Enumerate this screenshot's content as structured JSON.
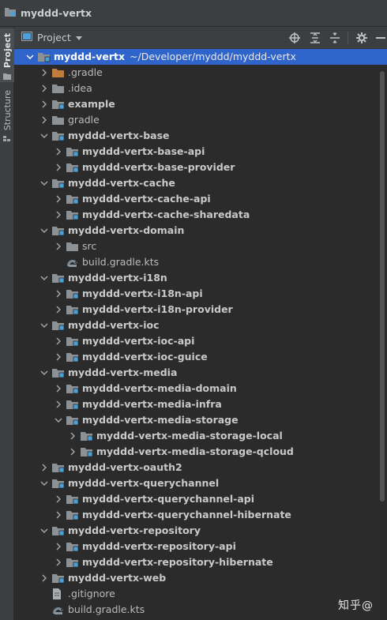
{
  "window": {
    "title": "myddd-vertx"
  },
  "sidebar_tabs": [
    {
      "label": "Project"
    },
    {
      "label": "Structure"
    }
  ],
  "toolbar": {
    "view_label": "Project"
  },
  "tree": [
    {
      "label": "myddd-vertx",
      "path": "~/Developer/myddd/myddd-vertx",
      "depth": 0,
      "expanded": true,
      "icon": "module-folder-icon",
      "bold": true,
      "selected": true
    },
    {
      "label": ".gradle",
      "depth": 1,
      "expanded": false,
      "icon": "excluded-folder-icon"
    },
    {
      "label": ".idea",
      "depth": 1,
      "expanded": false,
      "icon": "folder-icon"
    },
    {
      "label": "example",
      "depth": 1,
      "expanded": false,
      "icon": "module-folder-icon",
      "bold": true
    },
    {
      "label": "gradle",
      "depth": 1,
      "expanded": false,
      "icon": "folder-icon"
    },
    {
      "label": "myddd-vertx-base",
      "depth": 1,
      "expanded": true,
      "icon": "module-folder-icon",
      "bold": true
    },
    {
      "label": "myddd-vertx-base-api",
      "depth": 2,
      "expanded": false,
      "icon": "module-folder-icon",
      "bold": true
    },
    {
      "label": "myddd-vertx-base-provider",
      "depth": 2,
      "expanded": false,
      "icon": "module-folder-icon",
      "bold": true
    },
    {
      "label": "myddd-vertx-cache",
      "depth": 1,
      "expanded": true,
      "icon": "module-folder-icon",
      "bold": true
    },
    {
      "label": "myddd-vertx-cache-api",
      "depth": 2,
      "expanded": false,
      "icon": "module-folder-icon",
      "bold": true
    },
    {
      "label": "myddd-vertx-cache-sharedata",
      "depth": 2,
      "expanded": false,
      "icon": "module-folder-icon",
      "bold": true
    },
    {
      "label": "myddd-vertx-domain",
      "depth": 1,
      "expanded": true,
      "icon": "module-folder-icon",
      "bold": true
    },
    {
      "label": "src",
      "depth": 2,
      "expanded": false,
      "icon": "folder-icon"
    },
    {
      "label": "build.gradle.kts",
      "depth": 2,
      "leaf": true,
      "icon": "gradle-file-icon"
    },
    {
      "label": "myddd-vertx-i18n",
      "depth": 1,
      "expanded": true,
      "icon": "module-folder-icon",
      "bold": true
    },
    {
      "label": "myddd-vertx-i18n-api",
      "depth": 2,
      "expanded": false,
      "icon": "module-folder-icon",
      "bold": true
    },
    {
      "label": "myddd-vertx-i18n-provider",
      "depth": 2,
      "expanded": false,
      "icon": "module-folder-icon",
      "bold": true
    },
    {
      "label": "myddd-vertx-ioc",
      "depth": 1,
      "expanded": true,
      "icon": "module-folder-icon",
      "bold": true
    },
    {
      "label": "myddd-vertx-ioc-api",
      "depth": 2,
      "expanded": false,
      "icon": "module-folder-icon",
      "bold": true
    },
    {
      "label": "myddd-vertx-ioc-guice",
      "depth": 2,
      "expanded": false,
      "icon": "module-folder-icon",
      "bold": true
    },
    {
      "label": "myddd-vertx-media",
      "depth": 1,
      "expanded": true,
      "icon": "module-folder-icon",
      "bold": true
    },
    {
      "label": "myddd-vertx-media-domain",
      "depth": 2,
      "expanded": false,
      "icon": "module-folder-icon",
      "bold": true
    },
    {
      "label": "myddd-vertx-media-infra",
      "depth": 2,
      "expanded": false,
      "icon": "module-folder-icon",
      "bold": true
    },
    {
      "label": "myddd-vertx-media-storage",
      "depth": 2,
      "expanded": true,
      "icon": "module-folder-icon",
      "bold": true
    },
    {
      "label": "myddd-vertx-media-storage-local",
      "depth": 3,
      "expanded": false,
      "icon": "module-folder-icon",
      "bold": true
    },
    {
      "label": "myddd-vertx-media-storage-qcloud",
      "depth": 3,
      "expanded": false,
      "icon": "module-folder-icon",
      "bold": true
    },
    {
      "label": "myddd-vertx-oauth2",
      "depth": 1,
      "expanded": false,
      "icon": "module-folder-icon",
      "bold": true
    },
    {
      "label": "myddd-vertx-querychannel",
      "depth": 1,
      "expanded": true,
      "icon": "module-folder-icon",
      "bold": true
    },
    {
      "label": "myddd-vertx-querychannel-api",
      "depth": 2,
      "expanded": false,
      "icon": "module-folder-icon",
      "bold": true
    },
    {
      "label": "myddd-vertx-querychannel-hibernate",
      "depth": 2,
      "expanded": false,
      "icon": "module-folder-icon",
      "bold": true
    },
    {
      "label": "myddd-vertx-repository",
      "depth": 1,
      "expanded": true,
      "icon": "module-folder-icon",
      "bold": true
    },
    {
      "label": "myddd-vertx-repository-api",
      "depth": 2,
      "expanded": false,
      "icon": "module-folder-icon",
      "bold": true
    },
    {
      "label": "myddd-vertx-repository-hibernate",
      "depth": 2,
      "expanded": false,
      "icon": "module-folder-icon",
      "bold": true
    },
    {
      "label": "myddd-vertx-web",
      "depth": 1,
      "expanded": false,
      "icon": "module-folder-icon",
      "bold": true
    },
    {
      "label": ".gitignore",
      "depth": 1,
      "leaf": true,
      "icon": "text-file-icon"
    },
    {
      "label": "build.gradle.kts",
      "depth": 1,
      "leaf": true,
      "icon": "gradle-file-icon"
    }
  ],
  "watermark": "知乎@",
  "colors": {
    "background": "#2b2b2b",
    "panel": "#3c3f41",
    "selection": "#2f65ca",
    "folder": "#8c9196",
    "module_marker": "#4aa0d9",
    "excluded_folder": "#c27d3e"
  }
}
